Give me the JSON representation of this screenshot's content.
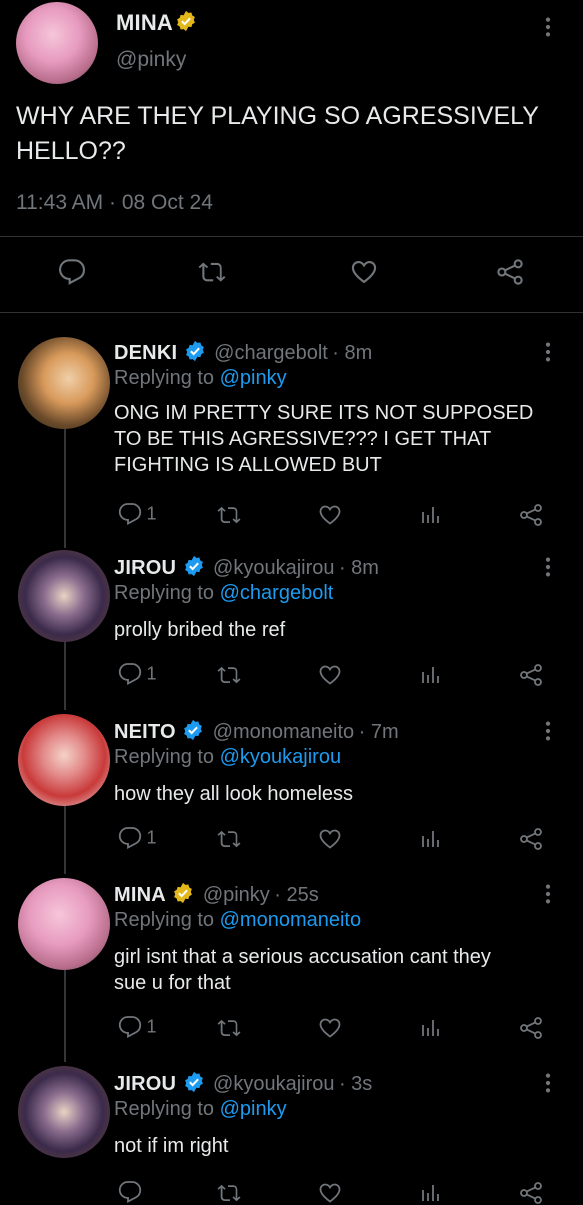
{
  "main_tweet": {
    "name": "MINA",
    "handle": "@pinky",
    "text_line1": "WHY ARE THEY PLAYING SO AGRESSIVELY",
    "text_line2": "HELLO??",
    "time": "11:43 AM",
    "sep": "·",
    "date": "08 Oct 24",
    "verified_color": "#e2b719"
  },
  "replies": [
    {
      "name": "DENKI",
      "handle": "@chargebolt",
      "time": "· 8m",
      "replying_label": "Replying to",
      "replying_to": "@pinky",
      "lines": [
        "ONG IM PRETTY SURE ITS NOT SUPPOSED",
        "TO BE THIS AGRESSIVE??? I GET THAT",
        "FIGHTING IS ALLOWED BUT"
      ],
      "reply_count": "1",
      "verified_color": "#1d9bf0"
    },
    {
      "name": "JIROU",
      "handle": "@kyoukajirou",
      "time": "· 8m",
      "replying_label": "Replying to",
      "replying_to": "@chargebolt",
      "lines": [
        "prolly bribed the ref"
      ],
      "reply_count": "1",
      "verified_color": "#1d9bf0"
    },
    {
      "name": "NEITO",
      "handle": "@monomaneito",
      "time": "· 7m",
      "replying_label": "Replying to",
      "replying_to": "@kyoukajirou",
      "lines": [
        "how they all look homeless"
      ],
      "reply_count": "1",
      "verified_color": "#1d9bf0"
    },
    {
      "name": "MINA",
      "handle": "@pinky",
      "time": "· 25s",
      "replying_label": "Replying to",
      "replying_to": "@monomaneito",
      "lines": [
        "girl isnt that a serious accusation cant they",
        "sue u for that"
      ],
      "reply_count": "1",
      "verified_color": "#e2b719"
    },
    {
      "name": "JIROU",
      "handle": "@kyoukajirou",
      "time": "· 3s",
      "replying_label": "Replying to",
      "replying_to": "@pinky",
      "lines": [
        "not if im right"
      ],
      "reply_count": "",
      "verified_color": "#1d9bf0"
    }
  ]
}
